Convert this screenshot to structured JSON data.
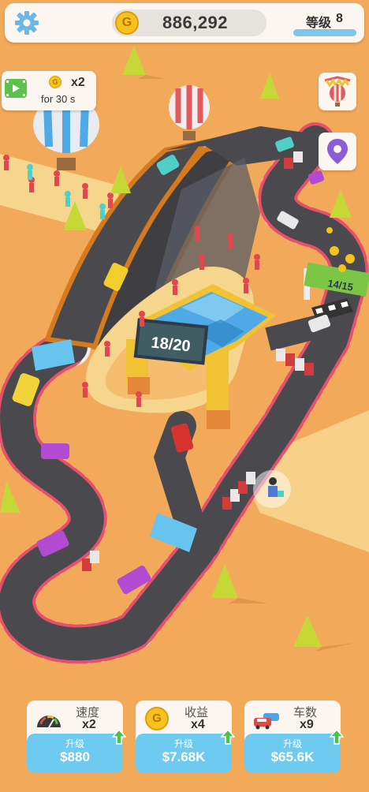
{
  "top_bar": {
    "coins": "886,292",
    "coin_symbol": "G",
    "level_label": "等级",
    "level": "8",
    "level_progress": 1.0
  },
  "boost": {
    "coin_symbol": "G",
    "multiplier": "x2",
    "duration": "for 30 s"
  },
  "track": {
    "checkpoint_sign": "18/20",
    "lap_sign": "14/15"
  },
  "upgrades": [
    {
      "name": "速度",
      "multiplier": "x2",
      "action": "升级",
      "price": "$880",
      "icon": "speedometer-icon"
    },
    {
      "name": "收益",
      "multiplier": "x4",
      "action": "升级",
      "price": "$7.68K",
      "icon": "coin-icon",
      "coin_symbol": "G"
    },
    {
      "name": "车数",
      "multiplier": "x9",
      "action": "升级",
      "price": "$65.6K",
      "icon": "cars-icon"
    }
  ],
  "colors": {
    "ground": "#f2a95a",
    "road": "#4a4a4e",
    "panel": "#fbf6f0",
    "button": "#6ecbef",
    "upgrade_arrow": "#4cc24a"
  }
}
